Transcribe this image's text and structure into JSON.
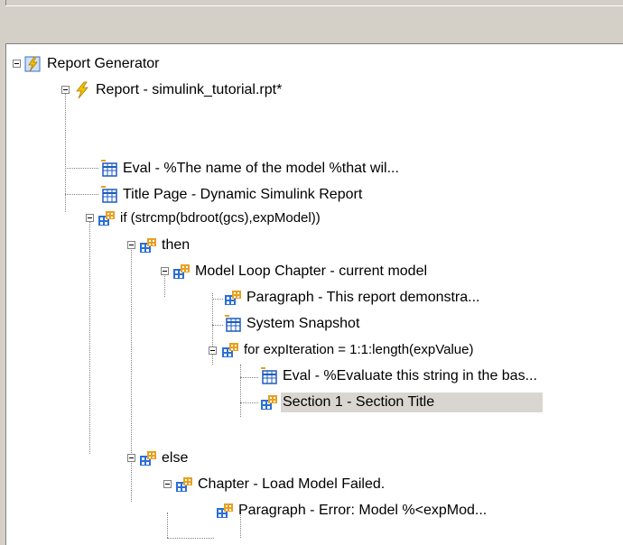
{
  "tree": {
    "nodes": [
      {
        "label": "Report Generator",
        "icon": "report-generator-icon"
      },
      {
        "label": "Report - simulink_tutorial.rpt*",
        "icon": "lightning-icon"
      },
      {
        "label": "Eval - %The name of the model %that wil...",
        "icon": "table-icon"
      },
      {
        "label": "Title Page - Dynamic Simulink Report",
        "icon": "table-icon"
      },
      {
        "label": "if (strcmp(bdroot(gcs),expModel))",
        "icon": "component-group-icon"
      },
      {
        "label": "then",
        "icon": "component-group-icon"
      },
      {
        "label": "Model Loop Chapter - current model",
        "icon": "component-group-icon"
      },
      {
        "label": "Paragraph - This report demonstra...",
        "icon": "component-group-icon"
      },
      {
        "label": "System Snapshot",
        "icon": "table-icon"
      },
      {
        "label": "for expIteration = 1:1:length(expValue)",
        "icon": "component-group-icon"
      },
      {
        "label": "Eval - %Evaluate this string in the bas...",
        "icon": "table-icon"
      },
      {
        "label": "Section 1 - Section Title",
        "icon": "component-group-icon",
        "selected": true
      },
      {
        "label": "else",
        "icon": "component-group-icon"
      },
      {
        "label": "Chapter - Load Model Failed.",
        "icon": "component-group-icon"
      },
      {
        "label": "Paragraph - Error: Model %<expMod...",
        "icon": "component-group-icon"
      }
    ]
  },
  "colors": {
    "panel": "#d4d0c8",
    "selection": "#d9d6d1",
    "group_icon_blue": "#2a6fd6",
    "group_icon_orange": "#e8a020",
    "table_icon_blue": "#1e5bbf",
    "lightning_yellow": "#f2c200"
  }
}
